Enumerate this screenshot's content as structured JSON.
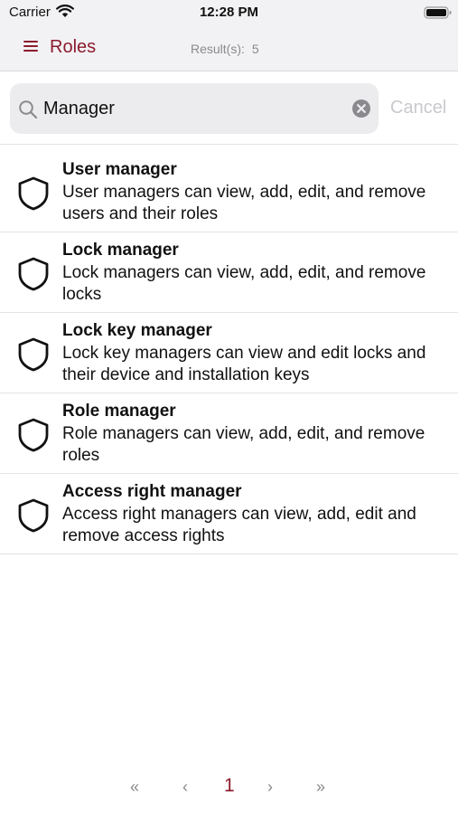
{
  "status_bar": {
    "carrier": "Carrier",
    "time": "12:28 PM"
  },
  "header": {
    "title": "Roles",
    "results_label": "Result(s):",
    "results_count": "5"
  },
  "search": {
    "value": "Manager",
    "cancel_label": "Cancel"
  },
  "roles": [
    {
      "name": "User manager",
      "description": "User managers can view, add, edit, and remove users and their roles",
      "icon": "shield-icon"
    },
    {
      "name": "Lock manager",
      "description": "Lock managers can view, add, edit, and remove locks",
      "icon": "shield-icon"
    },
    {
      "name": "Lock key manager",
      "description": "Lock key managers can view and edit locks and their device and installation keys",
      "icon": "shield-icon"
    },
    {
      "name": "Role manager",
      "description": "Role managers can view, add, edit, and remove roles",
      "icon": "shield-icon"
    },
    {
      "name": "Access right manager",
      "description": "Access right managers can view, add, edit and remove access rights",
      "icon": "shield-icon"
    }
  ],
  "pagination": {
    "first": "«",
    "prev": "‹",
    "current": "1",
    "next": "›",
    "last": "»"
  },
  "colors": {
    "accent": "#8c1c2e",
    "muted": "#8a8a8e",
    "cancel": "#c9c9ce",
    "bar_bg": "#f2f2f4"
  }
}
